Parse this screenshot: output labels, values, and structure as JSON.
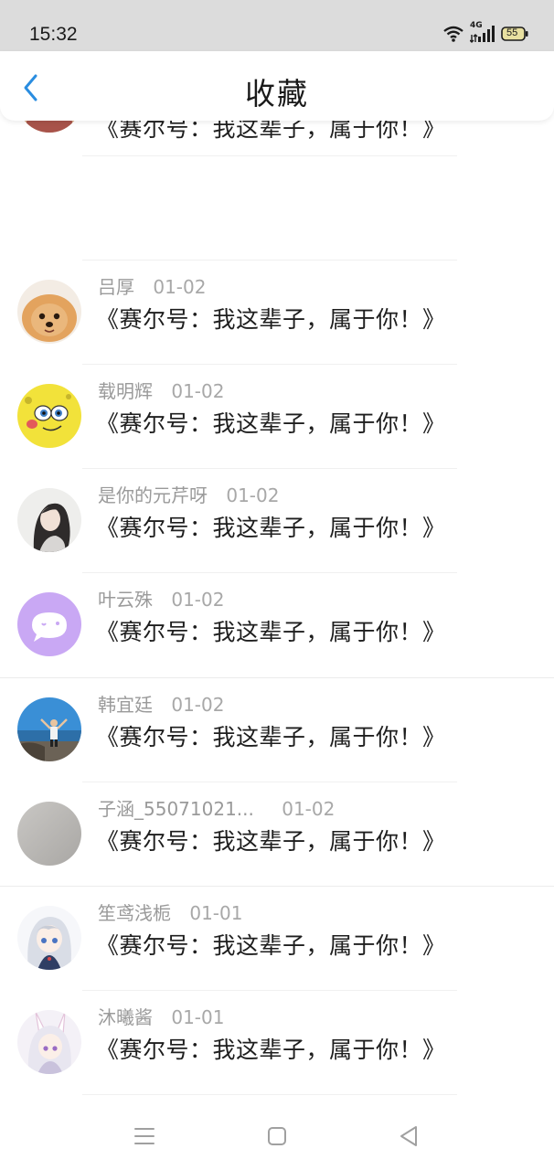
{
  "status_bar": {
    "time": "15:32",
    "network": "4G",
    "battery": "55"
  },
  "header": {
    "title": "收藏",
    "back_icon": "chevron-left-icon",
    "accent": "#2a8de0"
  },
  "partial_item": {
    "message": "《赛尔号：我这辈子，属于你！》"
  },
  "items": [
    {
      "user": "吕厚",
      "date": "01-02",
      "message": "《赛尔号：我这辈子，属于你！》",
      "avatar": "pomeranian-dog-photo"
    },
    {
      "user": "载明辉",
      "date": "01-02",
      "message": "《赛尔号：我这辈子，属于你！》",
      "avatar": "yellow-cartoon-face"
    },
    {
      "user": "是你的元芹呀",
      "date": "01-02",
      "message": "《赛尔号：我这辈子，属于你！》",
      "avatar": "girl-photo"
    },
    {
      "user": "叶云殊",
      "date": "01-02",
      "message": "《赛尔号：我这辈子，属于你！》",
      "avatar": "purple-chat-bubble"
    },
    {
      "user": "韩宜廷",
      "date": "01-02",
      "message": "《赛尔号：我这辈子，属于你！》",
      "avatar": "seaside-person-photo"
    },
    {
      "user": "子涵_55071021...",
      "date": "01-02",
      "message": "《赛尔号：我这辈子，属于你！》",
      "avatar": "gray-photo"
    },
    {
      "user": "笙鸢浅栀",
      "date": "01-01",
      "message": "《赛尔号：我这辈子，属于你！》",
      "avatar": "anime-girl-silver-hair"
    },
    {
      "user": "沐曦酱",
      "date": "01-01",
      "message": "《赛尔号：我这辈子，属于你！》",
      "avatar": "anime-girl-bunny-ears"
    }
  ],
  "bottom_nav": {
    "menu_icon": "menu-icon",
    "home_icon": "home-square-icon",
    "back_icon": "back-triangle-icon"
  }
}
